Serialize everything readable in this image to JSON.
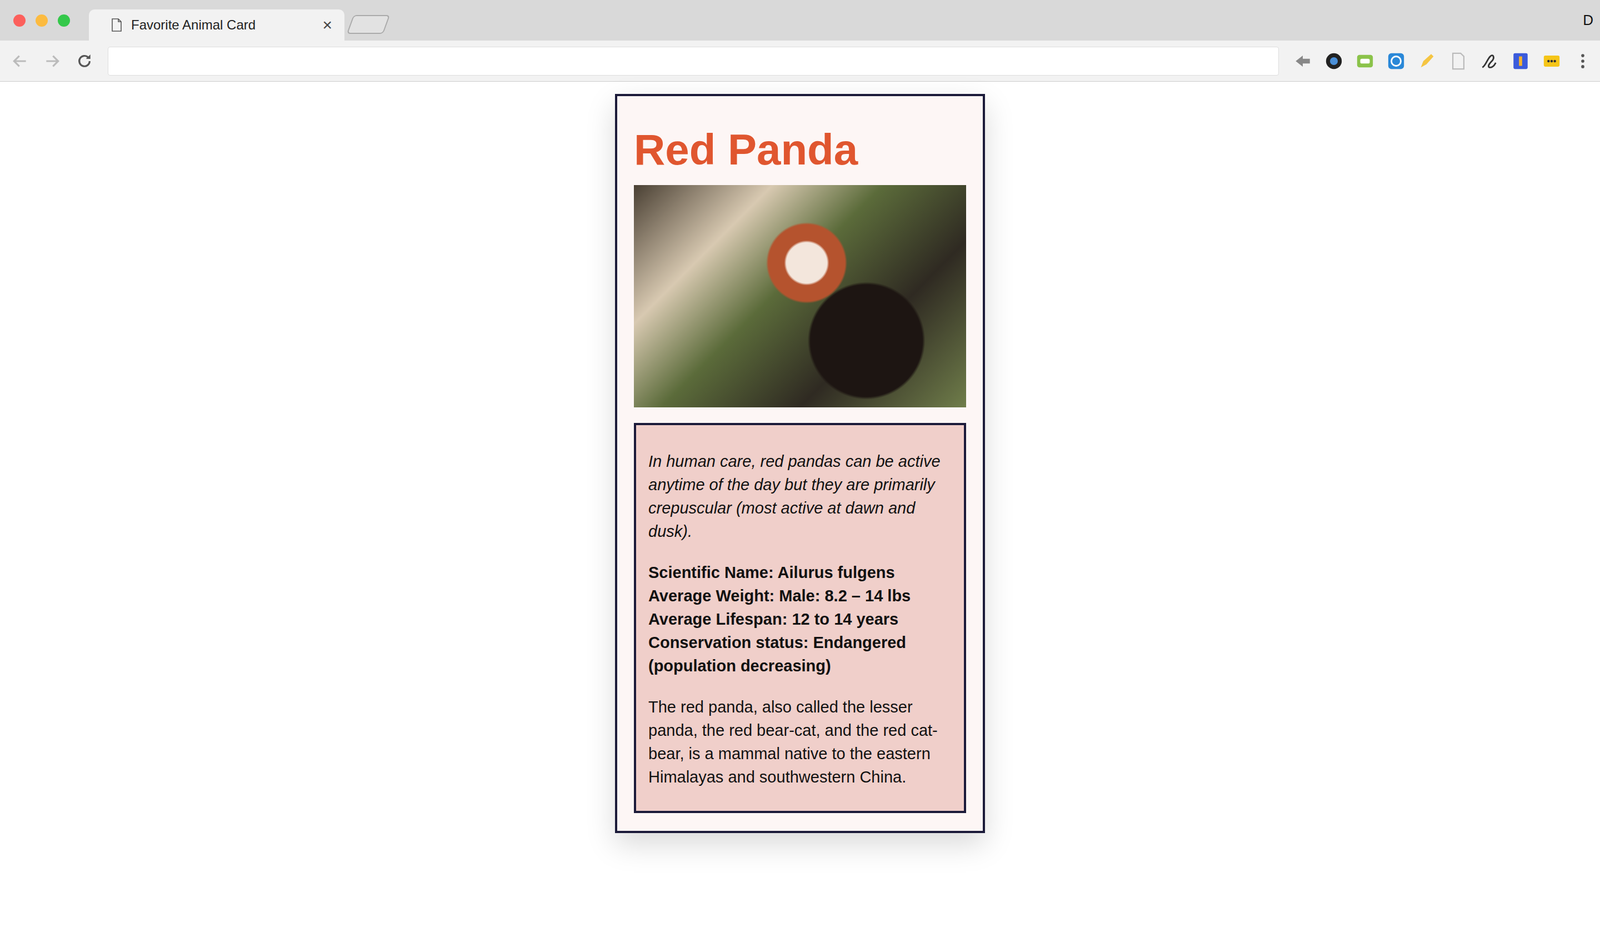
{
  "tabs": [
    {
      "label": "Favorite Animal Card",
      "selected": true,
      "close": "×"
    }
  ],
  "address_bar": {
    "value": ""
  },
  "profile": "D",
  "card": {
    "title": "Red Panda",
    "note": "In human care, red pandas can be active anytime of the day but they are primarily crepuscular (most active at dawn and dusk).",
    "facts": [
      "Scientific Name: Ailurus fulgens",
      "Average Weight: Male: 8.2 – 14 lbs",
      "Average Lifespan: 12 to 14 years",
      "Conservation status: Endangered (population decreasing)"
    ],
    "description": "The red panda, also called the lesser panda, the red bear-cat, and the red cat-bear, is a mammal native to the eastern Himalayas and southwestern China."
  }
}
